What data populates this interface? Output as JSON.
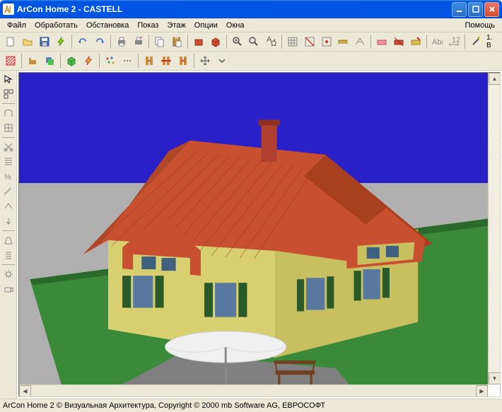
{
  "titlebar": {
    "text": "ArCon  Home 2 - CASTELL"
  },
  "menu": {
    "items": [
      "Файл",
      "Обработать",
      "Обстановка",
      "Показ",
      "Этаж",
      "Опции",
      "Окна"
    ],
    "help": "Помощь"
  },
  "toolbar_end": "1. B",
  "statusbar": {
    "text": "ArCon Home 2 © Визуальная Архитектура, Copyright © 2000 mb Software AG, ЕВРОСОФТ"
  }
}
